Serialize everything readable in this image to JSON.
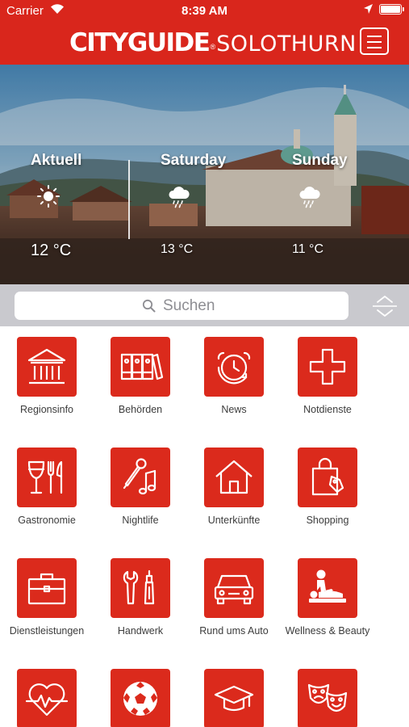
{
  "status_bar": {
    "carrier": "Carrier",
    "time": "8:39 AM"
  },
  "header": {
    "logo_part1": "CITYGUIDE",
    "logo_registered": "®",
    "logo_part2": "SOLOTHURN",
    "menu_icon": "hamburger-menu-icon"
  },
  "weather": [
    {
      "label": "Aktuell",
      "icon": "sun-icon",
      "temp": "12 °C"
    },
    {
      "label": "Saturday",
      "icon": "cloud-rain-icon",
      "temp": "13 °C"
    },
    {
      "label": "Sunday",
      "icon": "cloud-rain-icon",
      "temp": "11 °C"
    }
  ],
  "search": {
    "placeholder": "Suchen",
    "sort_icon": "sort-toggle-icon"
  },
  "categories": [
    {
      "label": "Regionsinfo",
      "icon": "bank-building-icon"
    },
    {
      "label": "Behörden",
      "icon": "binders-icon"
    },
    {
      "label": "News",
      "icon": "alarm-clock-icon"
    },
    {
      "label": "Notdienste",
      "icon": "medical-cross-icon"
    },
    {
      "label": "Gastronomie",
      "icon": "wine-cutlery-icon"
    },
    {
      "label": "Nightlife",
      "icon": "microphone-music-icon"
    },
    {
      "label": "Unterkünfte",
      "icon": "house-icon"
    },
    {
      "label": "Shopping",
      "icon": "shopping-bag-icon"
    },
    {
      "label": "Dienstleistungen",
      "icon": "briefcase-icon"
    },
    {
      "label": "Handwerk",
      "icon": "tools-icon"
    },
    {
      "label": "Rund ums Auto",
      "icon": "car-icon"
    },
    {
      "label": "Wellness & Beauty",
      "icon": "massage-icon"
    },
    {
      "label": "",
      "icon": "heart-pulse-icon"
    },
    {
      "label": "",
      "icon": "soccer-ball-icon"
    },
    {
      "label": "",
      "icon": "graduation-cap-icon"
    },
    {
      "label": "",
      "icon": "theater-masks-icon"
    }
  ],
  "colors": {
    "brand_red": "#d9261c",
    "tile_red": "#db2a1c",
    "search_bg": "#c9c9ce"
  }
}
